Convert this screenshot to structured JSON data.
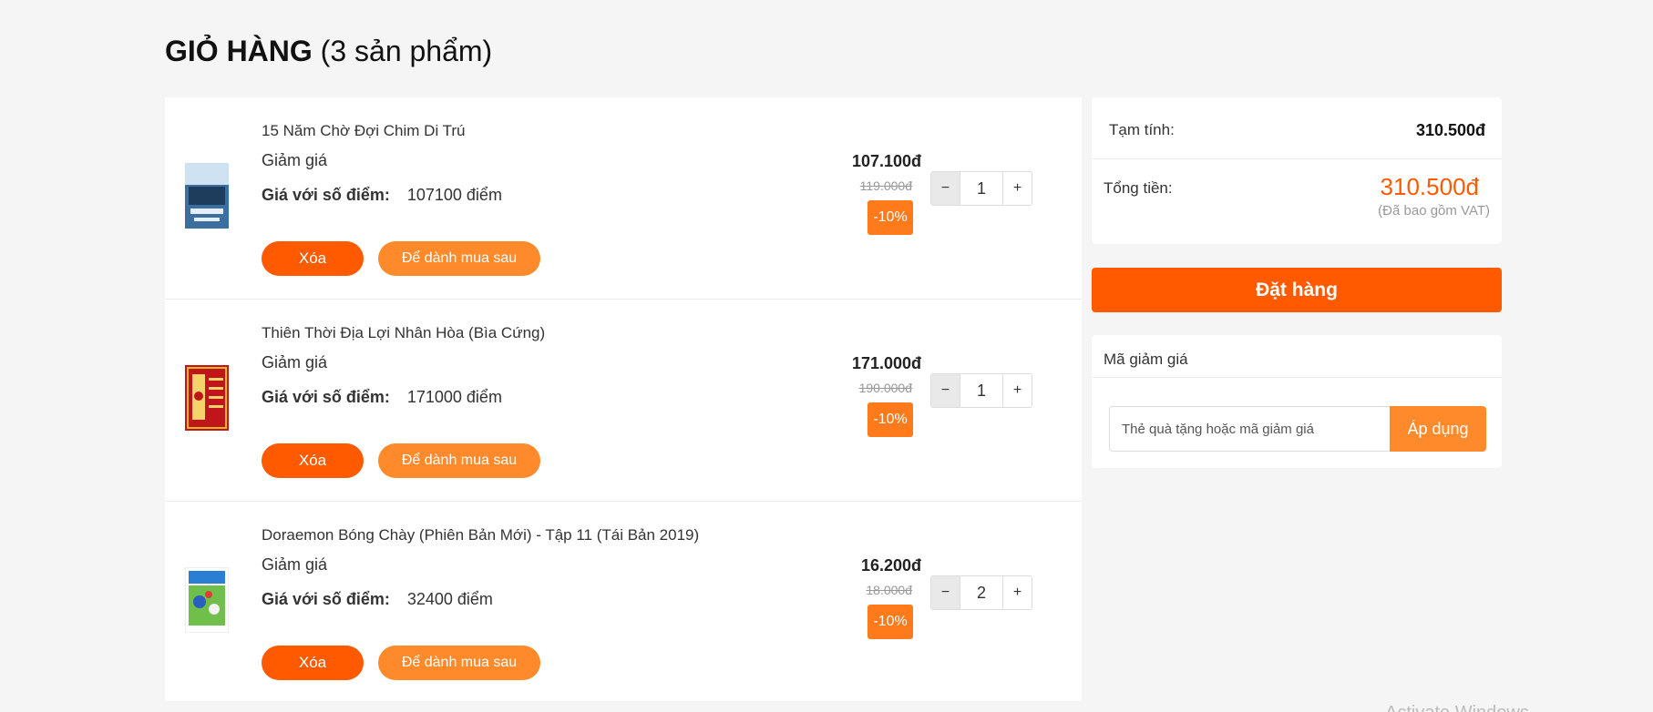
{
  "page": {
    "title": "GIỎ HÀNG",
    "count_text": "(3 sản phẩm)"
  },
  "cart": {
    "items": [
      {
        "name": "15 Năm Chờ Đợi Chim Di Trú",
        "discount_label": "Giảm giá",
        "points_label": "Giá với số điểm:",
        "points_value": "107100 điểm",
        "delete_label": "Xóa",
        "save_label": "Để dành mua sau",
        "price": "107.100đ",
        "old_price": "119.000đ",
        "discount": "-10%",
        "quantity": "1",
        "minus": "−",
        "plus": "+"
      },
      {
        "name": "Thiên Thời Địa Lợi Nhân Hòa (Bìa Cứng)",
        "discount_label": "Giảm giá",
        "points_label": "Giá với số điểm:",
        "points_value": "171000 điểm",
        "delete_label": "Xóa",
        "save_label": "Để dành mua sau",
        "price": "171.000đ",
        "old_price": "190.000đ",
        "discount": "-10%",
        "quantity": "1",
        "minus": "−",
        "plus": "+"
      },
      {
        "name": "Doraemon Bóng Chày (Phiên Bản Mới) - Tập 11 (Tái Bản 2019)",
        "discount_label": "Giảm giá",
        "points_label": "Giá với số điểm:",
        "points_value": "32400 điểm",
        "delete_label": "Xóa",
        "save_label": "Để dành mua sau",
        "price": "16.200đ",
        "old_price": "18.000đ",
        "discount": "-10%",
        "quantity": "2",
        "minus": "−",
        "plus": "+"
      }
    ]
  },
  "summary": {
    "subtotal_label": "Tạm tính:",
    "subtotal_value": "310.500đ",
    "total_label": "Tổng tiền:",
    "total_value": "310.500đ",
    "vat_note": "(Đã bao gồm VAT)"
  },
  "order_button": "Đặt hàng",
  "coupon": {
    "title": "Mã giảm giá",
    "placeholder": "Thẻ quà tặng hoặc mã giảm giá",
    "apply_label": "Áp dụng"
  },
  "colors": {
    "accent": "#ff5a00",
    "accent_light": "#ff8a2b",
    "background": "#f5f5f5"
  },
  "watermark": "Activate Windows"
}
